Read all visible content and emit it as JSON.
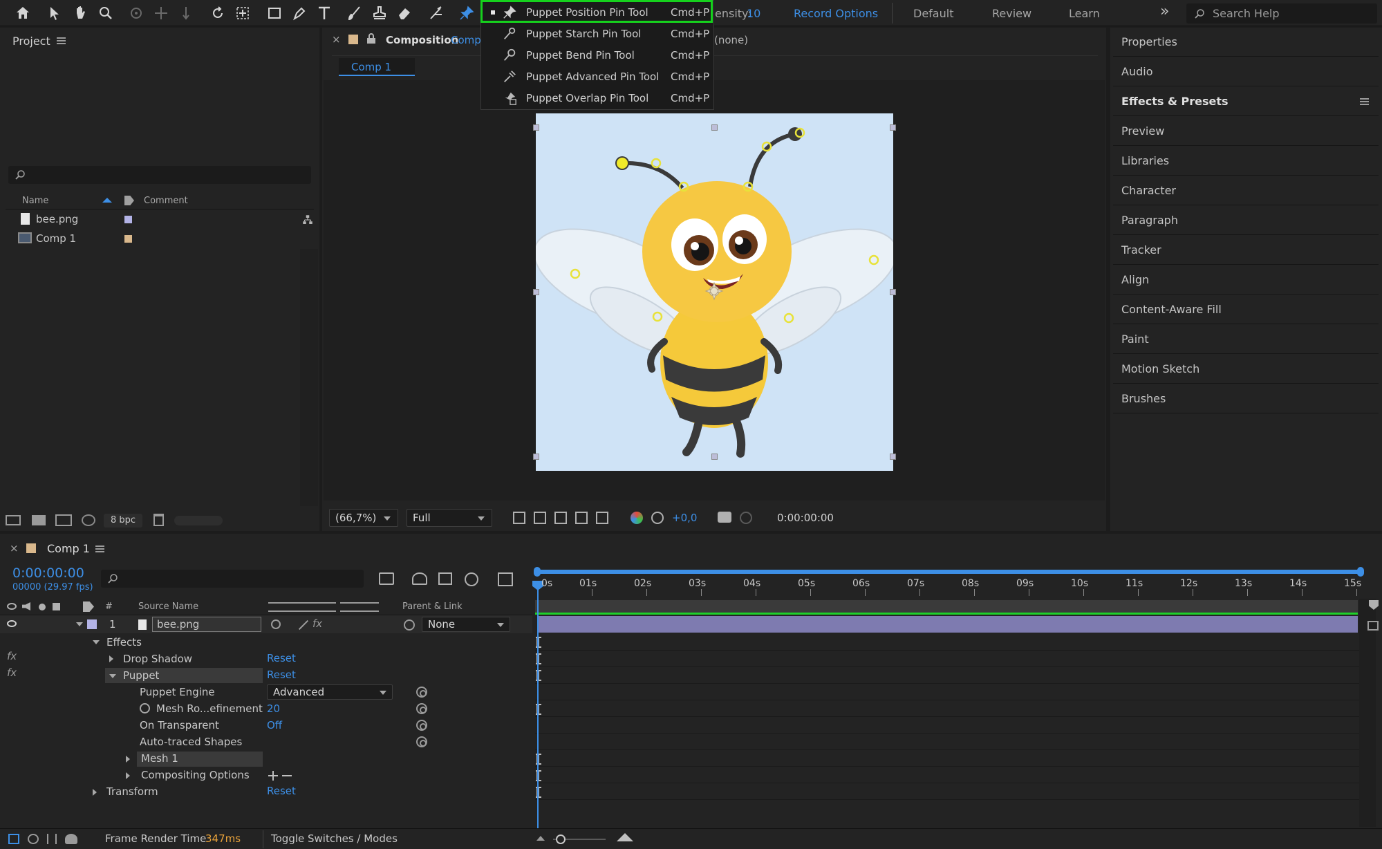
{
  "toolbar": {
    "tools": [
      "home-icon",
      "selection-tool-icon",
      "hand-tool-icon",
      "zoom-tool-icon",
      "orbit-camera-icon",
      "pan-camera-icon",
      "dolly-camera-icon",
      "rotation-tool-icon",
      "pan-behind-icon",
      "rectangle-tool-icon",
      "pen-tool-icon",
      "type-tool-icon",
      "brush-tool-icon",
      "clone-stamp-icon",
      "eraser-tool-icon",
      "roto-brush-icon",
      "puppet-pin-tool-icon"
    ],
    "density_label": "ensity:",
    "density_value": "10",
    "record_options": "Record Options",
    "workspaces": [
      "Default",
      "Review",
      "Learn"
    ],
    "overflow": "»",
    "search_placeholder": "Search Help"
  },
  "pin_menu": {
    "items": [
      {
        "label": "Puppet Position Pin Tool",
        "shortcut": "Cmd+P",
        "icon": "puppet-position-pin-icon",
        "selected": true
      },
      {
        "label": "Puppet Starch Pin Tool",
        "shortcut": "Cmd+P",
        "icon": "puppet-starch-pin-icon",
        "selected": false
      },
      {
        "label": "Puppet Bend Pin Tool",
        "shortcut": "Cmd+P",
        "icon": "puppet-bend-pin-icon",
        "selected": false
      },
      {
        "label": "Puppet Advanced Pin Tool",
        "shortcut": "Cmd+P",
        "icon": "puppet-advanced-pin-icon",
        "selected": false
      },
      {
        "label": "Puppet Overlap Pin Tool",
        "shortcut": "Cmd+P",
        "icon": "puppet-overlap-pin-icon",
        "selected": false
      }
    ]
  },
  "project": {
    "title": "Project",
    "columns": {
      "name": "Name",
      "comment": "Comment"
    },
    "items": [
      {
        "name": "bee.png",
        "color": "#b3b3e6"
      },
      {
        "name": "Comp 1",
        "color": "#d9b88c"
      }
    ],
    "bpc": "8 bpc"
  },
  "composition": {
    "tab_label": "Composition",
    "tab_name": "Comp",
    "layer_suffix": "(none)",
    "sub_tab": "Comp 1",
    "zoom": "(66,7%)",
    "resolution": "Full",
    "exposure": "+0,0",
    "timecode": "0:00:00:00"
  },
  "right_panel": {
    "items": [
      "Properties",
      "Audio",
      "Effects & Presets",
      "Preview",
      "Libraries",
      "Character",
      "Paragraph",
      "Tracker",
      "Align",
      "Content-Aware Fill",
      "Paint",
      "Motion Sketch",
      "Brushes"
    ]
  },
  "timeline": {
    "tab": "Comp 1",
    "current_time": "0:00:00:00",
    "frame_info": "00000 (29.97 fps)",
    "ruler": [
      "0s",
      "01s",
      "02s",
      "03s",
      "04s",
      "05s",
      "06s",
      "07s",
      "08s",
      "09s",
      "10s",
      "11s",
      "12s",
      "13s",
      "14s",
      "15s"
    ],
    "columns": {
      "num": "#",
      "source": "Source Name",
      "parent": "Parent & Link"
    },
    "layer": {
      "index": "1",
      "name": "bee.png",
      "parent": "None"
    },
    "effects_label": "Effects",
    "drop_shadow": "Drop Shadow",
    "puppet": "Puppet",
    "reset": "Reset",
    "puppet_engine_label": "Puppet Engine",
    "puppet_engine_value": "Advanced",
    "mesh_refinement_label": "Mesh Ro...efinement",
    "mesh_refinement_value": "20",
    "on_transparent_label": "On Transparent",
    "on_transparent_value": "Off",
    "auto_traced": "Auto-traced Shapes",
    "mesh1": "Mesh 1",
    "compositing": "Compositing Options",
    "transform": "Transform",
    "fx": "fx"
  },
  "status": {
    "frame_render_label": "Frame Render Time",
    "frame_render_value": "347ms",
    "toggle": "Toggle Switches / Modes"
  }
}
